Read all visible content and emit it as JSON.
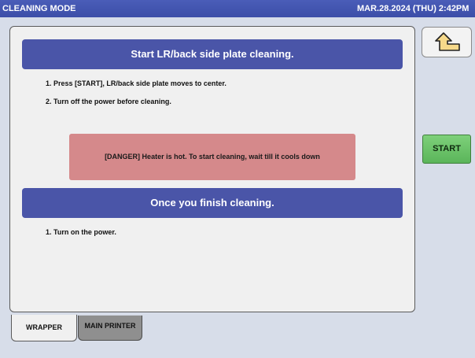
{
  "window": {
    "title": "CLEANING MODE",
    "datetime": "MAR.28.2024 (THU)  2:42PM"
  },
  "section1": {
    "header": "Start LR/back side plate cleaning.",
    "steps": [
      "1. Press [START], LR/back side plate moves to center.",
      "2. Turn off the power before cleaning."
    ]
  },
  "danger": {
    "text": "[DANGER] Heater is hot. To start cleaning, wait till it cools down"
  },
  "section2": {
    "header": "Once you finish cleaning.",
    "steps": [
      "1. Turn on the power."
    ]
  },
  "buttons": {
    "back_icon": "return-arrow-icon",
    "start_label": "START"
  },
  "tabs": [
    {
      "label": "WRAPPER",
      "active": true
    },
    {
      "label": "MAIN PRINTER",
      "active": false
    }
  ],
  "colors": {
    "titlebar": "#3c4ea8",
    "header_bar": "#4a55a8",
    "danger": "#d5898b",
    "start": "#6cc46a",
    "background": "#d7dde9"
  }
}
